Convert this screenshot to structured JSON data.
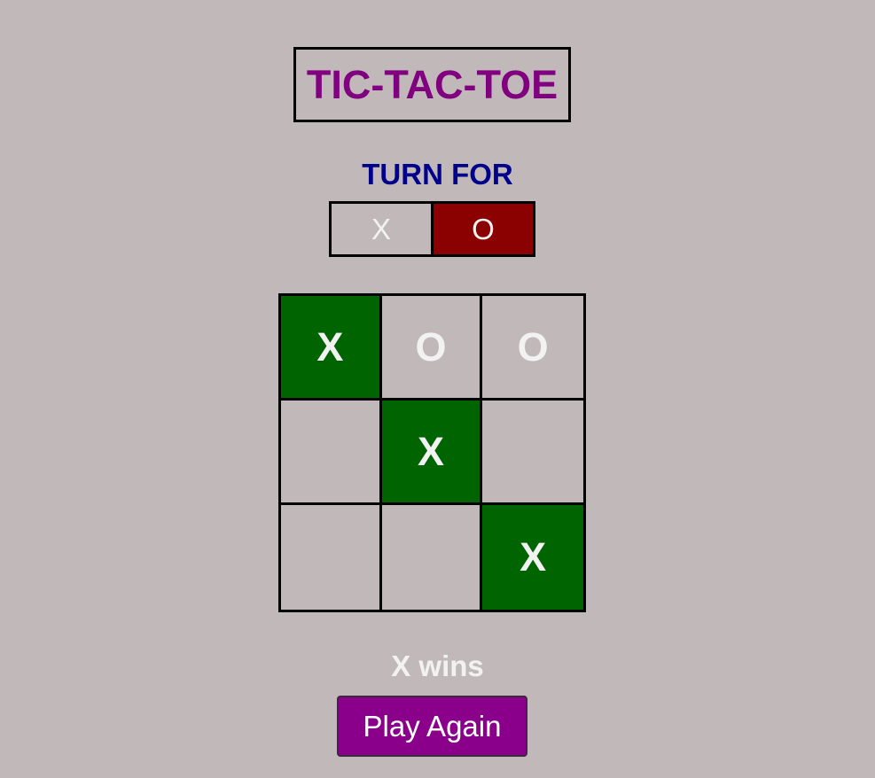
{
  "title": "TIC-TAC-TOE",
  "turn": {
    "label": "TURN FOR",
    "options": [
      "X",
      "O"
    ],
    "active": "O"
  },
  "board": {
    "cells": [
      "X",
      "O",
      "O",
      "",
      "X",
      "",
      "",
      "",
      "X"
    ],
    "winning_cells": [
      0,
      4,
      8
    ]
  },
  "result": "X wins",
  "play_again_label": "Play Again",
  "colors": {
    "background": "#c1b9b9",
    "title": "#800080",
    "turn_label": "#00008b",
    "active_turn": "#8b0000",
    "win_cell": "#006400",
    "button": "#8b008b"
  }
}
